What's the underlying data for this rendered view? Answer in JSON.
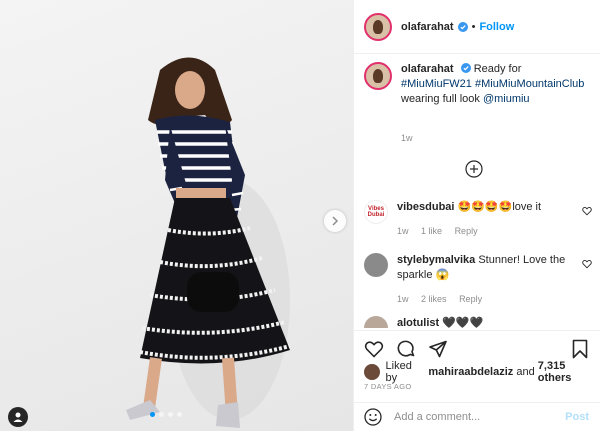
{
  "post": {
    "username": "olafarahat",
    "follow_label": "Follow",
    "dot": "•",
    "caption_intro": "Ready for",
    "caption_tag1": "#MiuMiuFW21",
    "caption_tag2": "#MiuMiuMountainClub",
    "caption_mid": "wearing full look",
    "caption_mention": "@miumiu",
    "time_ago": "1w"
  },
  "comments": [
    {
      "username": "vibesdubai",
      "avatar_text": "Vibes Dubai",
      "text": "🤩🤩🤩🤩love it",
      "time": "1w",
      "likes": "1 like",
      "reply": "Reply"
    },
    {
      "username": "stylebymalvika",
      "text": "Stunner! Love the sparkle 😱",
      "time": "1w",
      "likes": "2 likes",
      "reply": "Reply"
    },
    {
      "username": "alotulist",
      "text": "🖤🖤🖤"
    }
  ],
  "likes": {
    "prefix": "Liked by",
    "liker": "mahiraabdelaziz",
    "middle": "and",
    "count": "7,315 others"
  },
  "date": "7 DAYS AGO",
  "add_comment": {
    "placeholder": "Add a comment...",
    "post_label": "Post"
  },
  "colors": {
    "accent": "#0095f6",
    "link": "#00376b",
    "muted": "#8e8e8e",
    "heart_emoji": "#e0245e"
  },
  "icons": {
    "like": "heart-icon",
    "comment": "comment-icon",
    "share": "paper-plane-icon",
    "save": "bookmark-icon",
    "load_more": "plus-circle-icon",
    "next": "chevron-right-icon",
    "tag": "user-tag-icon",
    "emoji": "smiley-icon",
    "verified": "verified-badge-icon"
  }
}
